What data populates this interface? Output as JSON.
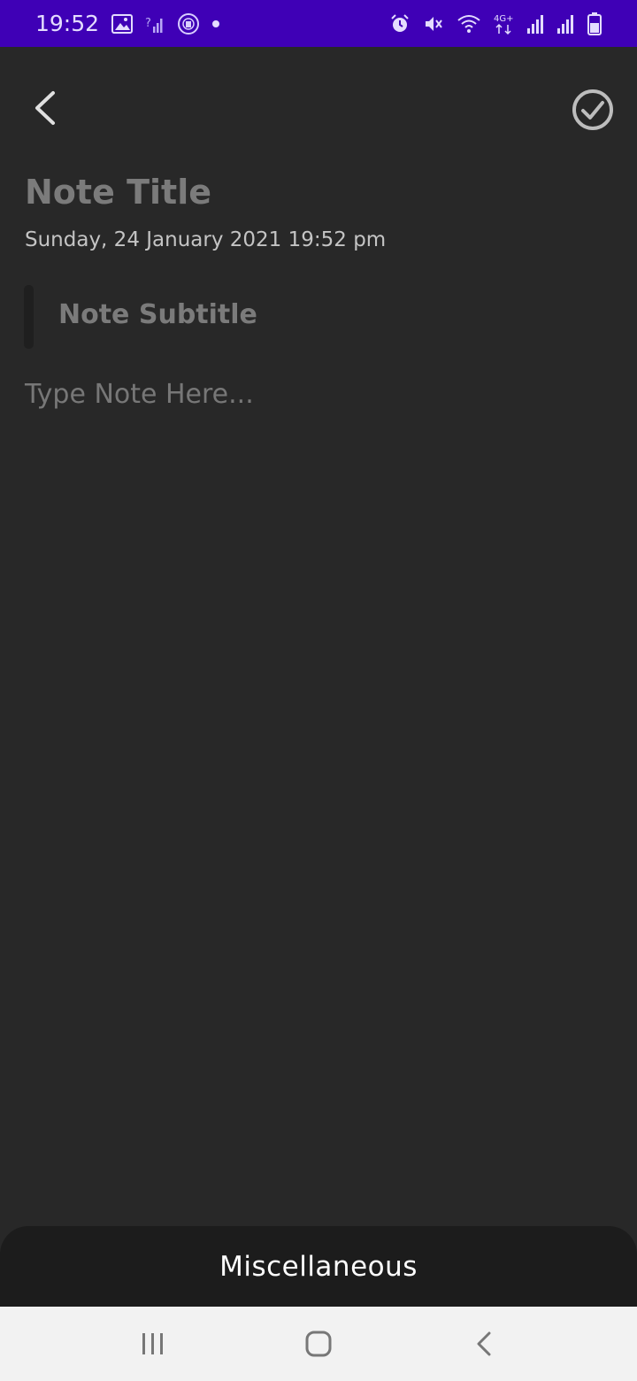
{
  "status_bar": {
    "time": "19:52",
    "left_icons": [
      "image-icon",
      "no-signal-icon",
      "club-badge-icon",
      "notification-dot-icon"
    ],
    "right_icons": [
      "alarm-icon",
      "mute-icon",
      "wifi-icon",
      "4g-plus-icon",
      "signal-1-icon",
      "signal-2-icon",
      "battery-icon"
    ],
    "network_label": "4G+"
  },
  "toolbar": {
    "back_icon": "chevron-left-icon",
    "save_icon": "check-circle-icon"
  },
  "note": {
    "title_placeholder": "Note Title",
    "date_time": "Sunday, 24 January 2021 19:52 pm",
    "subtitle_placeholder": "Note Subtitle",
    "body_placeholder": "Type Note Here..."
  },
  "misc": {
    "label": "Miscellaneous"
  },
  "nav_bar": {
    "recents_icon": "recents-icon",
    "home_icon": "home-icon",
    "back_icon": "back-icon"
  },
  "colors": {
    "status_bar_bg": "#3f00b6",
    "background": "#282828",
    "sheet_bg": "#1c1c1c",
    "nav_bg": "#f2f2f2"
  }
}
